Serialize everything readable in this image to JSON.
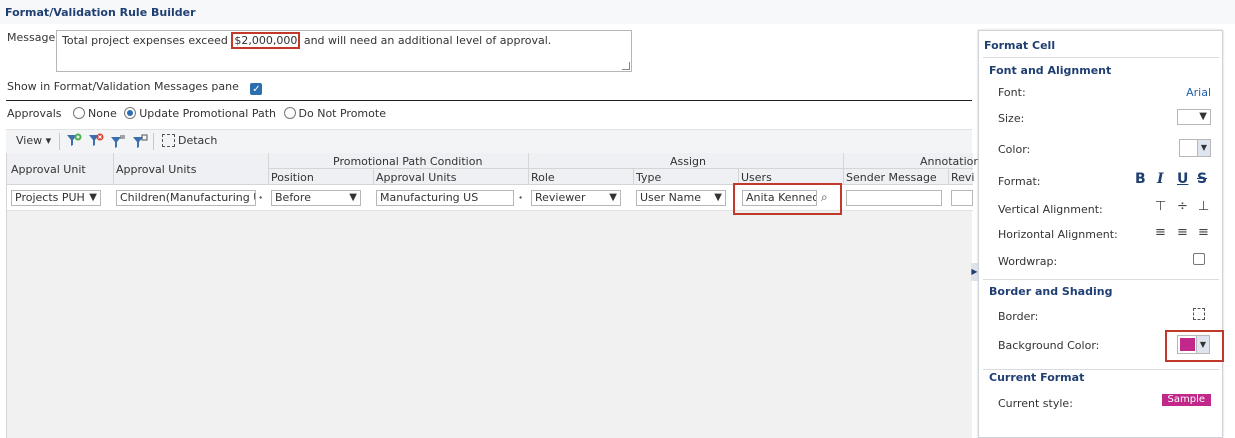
{
  "app": {
    "title": "Format/Validation Rule Builder"
  },
  "message": {
    "label": "Message",
    "before": "Total project expenses exceed ",
    "amount": "$2,000,000",
    "after": " and will need an additional level of approval."
  },
  "show_pane": {
    "label": "Show in Format/Validation Messages pane",
    "checked": true
  },
  "approvals": {
    "label": "Approvals",
    "options": [
      "None",
      "Update Promotional Path",
      "Do Not Promote"
    ],
    "selected": "Update Promotional Path"
  },
  "toolbar": {
    "view_label": "View",
    "detach_label": "Detach"
  },
  "grid": {
    "groups": {
      "promo": "Promotional Path Condition",
      "assign": "Assign",
      "annotation": "Annotation"
    },
    "headers": {
      "approval_unit": "Approval Unit",
      "approval_units": "Approval Units",
      "position": "Position",
      "pp_approval_units": "Approval Units",
      "role": "Role",
      "type": "Type",
      "users": "Users",
      "sender_message": "Sender Message",
      "revi": "Revi"
    },
    "row": {
      "approval_unit": "Projects PUH",
      "approval_units": "Children(Manufacturing US",
      "position": "Before",
      "pp_approval_units": "Manufacturing US",
      "role": "Reviewer",
      "type": "User Name",
      "users": "Anita Kennedy",
      "sender_message": ""
    }
  },
  "panel": {
    "title": "Format Cell",
    "font_section": "Font and Alignment",
    "font_label": "Font:",
    "font_value": "Arial",
    "size_label": "Size:",
    "color_label": "Color:",
    "format_label": "Format:",
    "valign_label": "Vertical Alignment:",
    "halign_label": "Horizontal Alignment:",
    "wordwrap_label": "Wordwrap:",
    "border_section": "Border and Shading",
    "border_label": "Border:",
    "bg_label": "Background Color:",
    "bg_color": "#c2278a",
    "current_section": "Current Format",
    "current_label": "Current style:",
    "sample": "Sample"
  }
}
